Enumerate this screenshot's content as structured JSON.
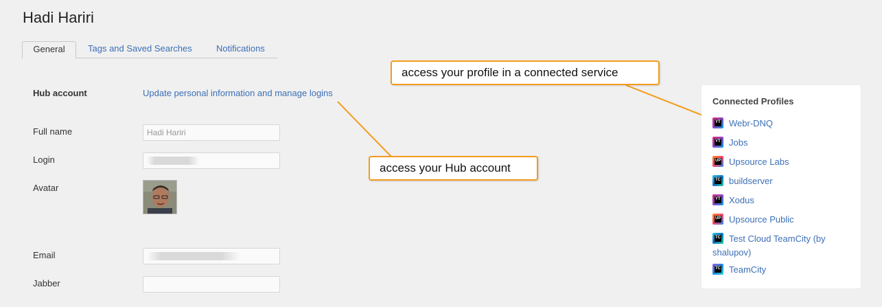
{
  "page_title": "Hadi Hariri",
  "tabs": [
    {
      "label": "General",
      "active": true
    },
    {
      "label": "Tags and Saved Searches",
      "active": false
    },
    {
      "label": "Notifications",
      "active": false
    }
  ],
  "form": {
    "hub_account_label": "Hub account",
    "hub_account_link": "Update personal information and manage logins",
    "full_name_label": "Full name",
    "full_name_value": "Hadi Hariri",
    "login_label": "Login",
    "avatar_label": "Avatar",
    "email_label": "Email",
    "jabber_label": "Jabber"
  },
  "callouts": {
    "profile": "access your profile in a connected service",
    "hub": "access your Hub account"
  },
  "connected_profiles": {
    "title": "Connected Profiles",
    "items": [
      {
        "name": "Webr-DNQ",
        "icon": "youtrack-icon",
        "badge": "YT"
      },
      {
        "name": "Jobs",
        "icon": "youtrack-icon",
        "badge": "YT"
      },
      {
        "name": "Upsource Labs",
        "icon": "upsource-icon",
        "badge": "UP"
      },
      {
        "name": "buildserver",
        "icon": "teamcity-icon",
        "badge": "TC"
      },
      {
        "name": "Xodus",
        "icon": "youtrack-icon",
        "badge": "YT"
      },
      {
        "name": "Upsource Public",
        "icon": "upsource-icon",
        "badge": "UP"
      },
      {
        "name": "Test Cloud TeamCity (by shalupov)",
        "icon": "teamcity-icon",
        "badge": "TC"
      },
      {
        "name": "TeamCity",
        "icon": "teamcity-icon",
        "badge": "TC"
      }
    ]
  },
  "colors": {
    "link": "#3d6fb6",
    "callout_border": "#f39c1f",
    "background": "#f0f0f0"
  }
}
